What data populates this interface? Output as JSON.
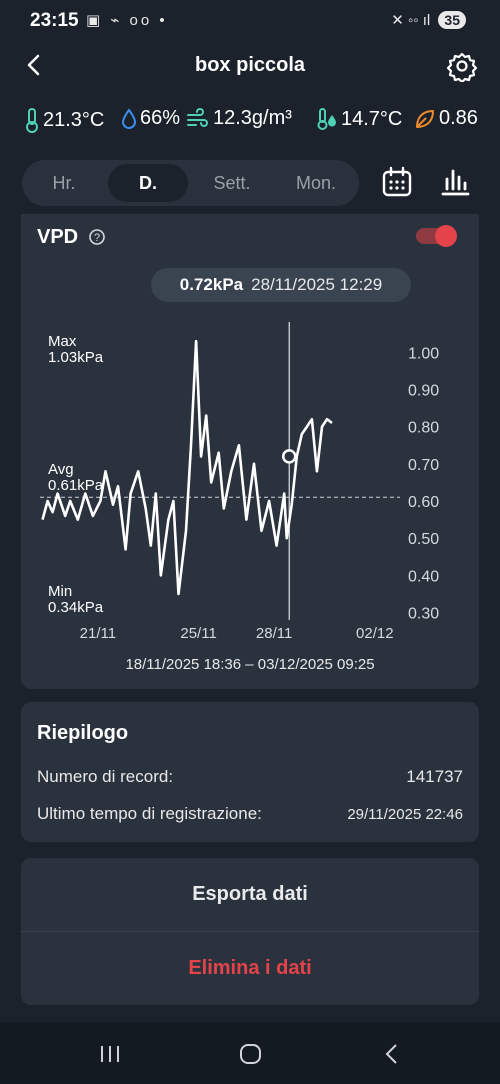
{
  "status": {
    "time": "23:15",
    "icons": "▣ ⌁ oo •",
    "signal": "◦◦ ıl",
    "battery": "35"
  },
  "header": {
    "title": "box piccola"
  },
  "metrics": {
    "temperature": "21.3°C",
    "humidity": "66%",
    "abs_humidity": "12.3g/m³",
    "dew_point": "14.7°C",
    "vpd": "0.86"
  },
  "tabs": [
    "Hr.",
    "D.",
    "Sett.",
    "Mon."
  ],
  "chart": {
    "title": "VPD",
    "tooltip_value": "0.72kPa",
    "tooltip_time": "28/11/2025 12:29",
    "max_label": "Max",
    "max_value": "1.03kPa",
    "avg_label": "Avg",
    "avg_value": "0.61kPa",
    "min_label": "Min",
    "min_value": "0.34kPa",
    "range": "18/11/2025 18:36 – 03/12/2025 09:25",
    "colors": {
      "line": "#ffffff",
      "toggle": "#e5434a"
    }
  },
  "chart_data": {
    "type": "line",
    "ylim": [
      0.28,
      1.06
    ],
    "y_ticks": [
      "1.00",
      "0.90",
      "0.80",
      "0.70",
      "0.60",
      "0.50",
      "0.40",
      "0.30"
    ],
    "x_ticks": [
      "21/11",
      "25/11",
      "28/11",
      "02/12"
    ],
    "avg": 0.61,
    "cursor_x": 28.6,
    "cursor_y": 0.72,
    "series": [
      {
        "x": [
          18.8,
          19.0,
          19.2,
          19.4,
          19.7,
          19.9,
          20.2,
          20.5,
          20.8,
          21.1,
          21.3,
          21.6,
          21.8,
          22.1,
          22.3,
          22.6,
          22.9,
          23.1,
          23.3,
          23.5,
          23.8,
          24.0,
          24.2,
          24.5,
          24.7,
          24.9,
          25.1,
          25.3,
          25.5,
          25.8,
          26.0,
          26.3,
          26.6,
          26.9,
          27.2,
          27.5,
          27.8,
          28.1,
          28.4,
          28.5,
          28.7,
          28.9,
          29.1,
          29.3,
          29.5,
          29.7,
          29.9,
          30.1,
          30.3
        ],
        "y": [
          0.55,
          0.6,
          0.57,
          0.62,
          0.56,
          0.6,
          0.55,
          0.62,
          0.56,
          0.6,
          0.68,
          0.59,
          0.64,
          0.47,
          0.62,
          0.68,
          0.58,
          0.48,
          0.62,
          0.4,
          0.55,
          0.6,
          0.35,
          0.52,
          0.75,
          1.03,
          0.72,
          0.83,
          0.65,
          0.73,
          0.58,
          0.68,
          0.75,
          0.55,
          0.7,
          0.52,
          0.6,
          0.48,
          0.62,
          0.5,
          0.59,
          0.72,
          0.78,
          0.8,
          0.82,
          0.68,
          0.8,
          0.82,
          0.81
        ]
      }
    ]
  },
  "summary": {
    "title": "Riepilogo",
    "records_label": "Numero di record:",
    "records_value": "141737",
    "last_label": "Ultimo tempo di registrazione:",
    "last_value": "29/11/2025 22:46"
  },
  "actions": {
    "export": "Esporta dati",
    "delete": "Elimina i dati"
  },
  "nav": {
    "recent": "|||",
    "home": "○",
    "back": "<"
  }
}
